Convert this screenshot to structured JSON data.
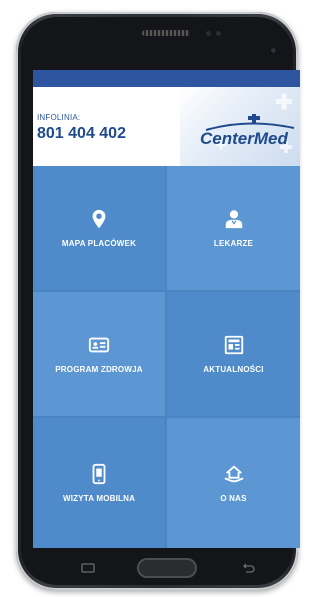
{
  "header": {
    "info_label": "INFOLINIA:",
    "info_phone": "801 404 402",
    "logo_text": "CenterMed"
  },
  "tiles": [
    {
      "label": "MAPA PLACÓWEK",
      "icon": "map-pin-icon"
    },
    {
      "label": "LEKARZE",
      "icon": "doctor-icon"
    },
    {
      "label": "PROGRAM ZDROWJA",
      "icon": "id-card-icon"
    },
    {
      "label": "AKTUALNOŚCI",
      "icon": "newspaper-icon"
    },
    {
      "label": "WIZYTA MOBILNA",
      "icon": "mobile-phone-icon"
    },
    {
      "label": "O NAS",
      "icon": "house-hand-icon"
    }
  ],
  "colors": {
    "status_bar": "#2d55a0",
    "tile_primary": "#4f8bcb",
    "tile_alt": "#5c97d3",
    "brand_blue": "#1f4a8e"
  }
}
